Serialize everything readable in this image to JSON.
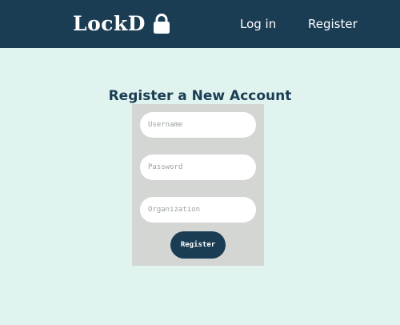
{
  "header": {
    "logo_text": "LockD",
    "logo_icon": "lock-icon",
    "nav": {
      "login_label": "Log in",
      "register_label": "Register"
    }
  },
  "main": {
    "title": "Register a New Account",
    "form": {
      "username_placeholder": "Username",
      "password_placeholder": "Password",
      "organization_placeholder": "Organization",
      "submit_label": "Register"
    }
  },
  "colors": {
    "navbar": "#1a3d54",
    "background": "#e1f3ef",
    "card": "#d3d6d2",
    "accent": "#1a3d54"
  }
}
